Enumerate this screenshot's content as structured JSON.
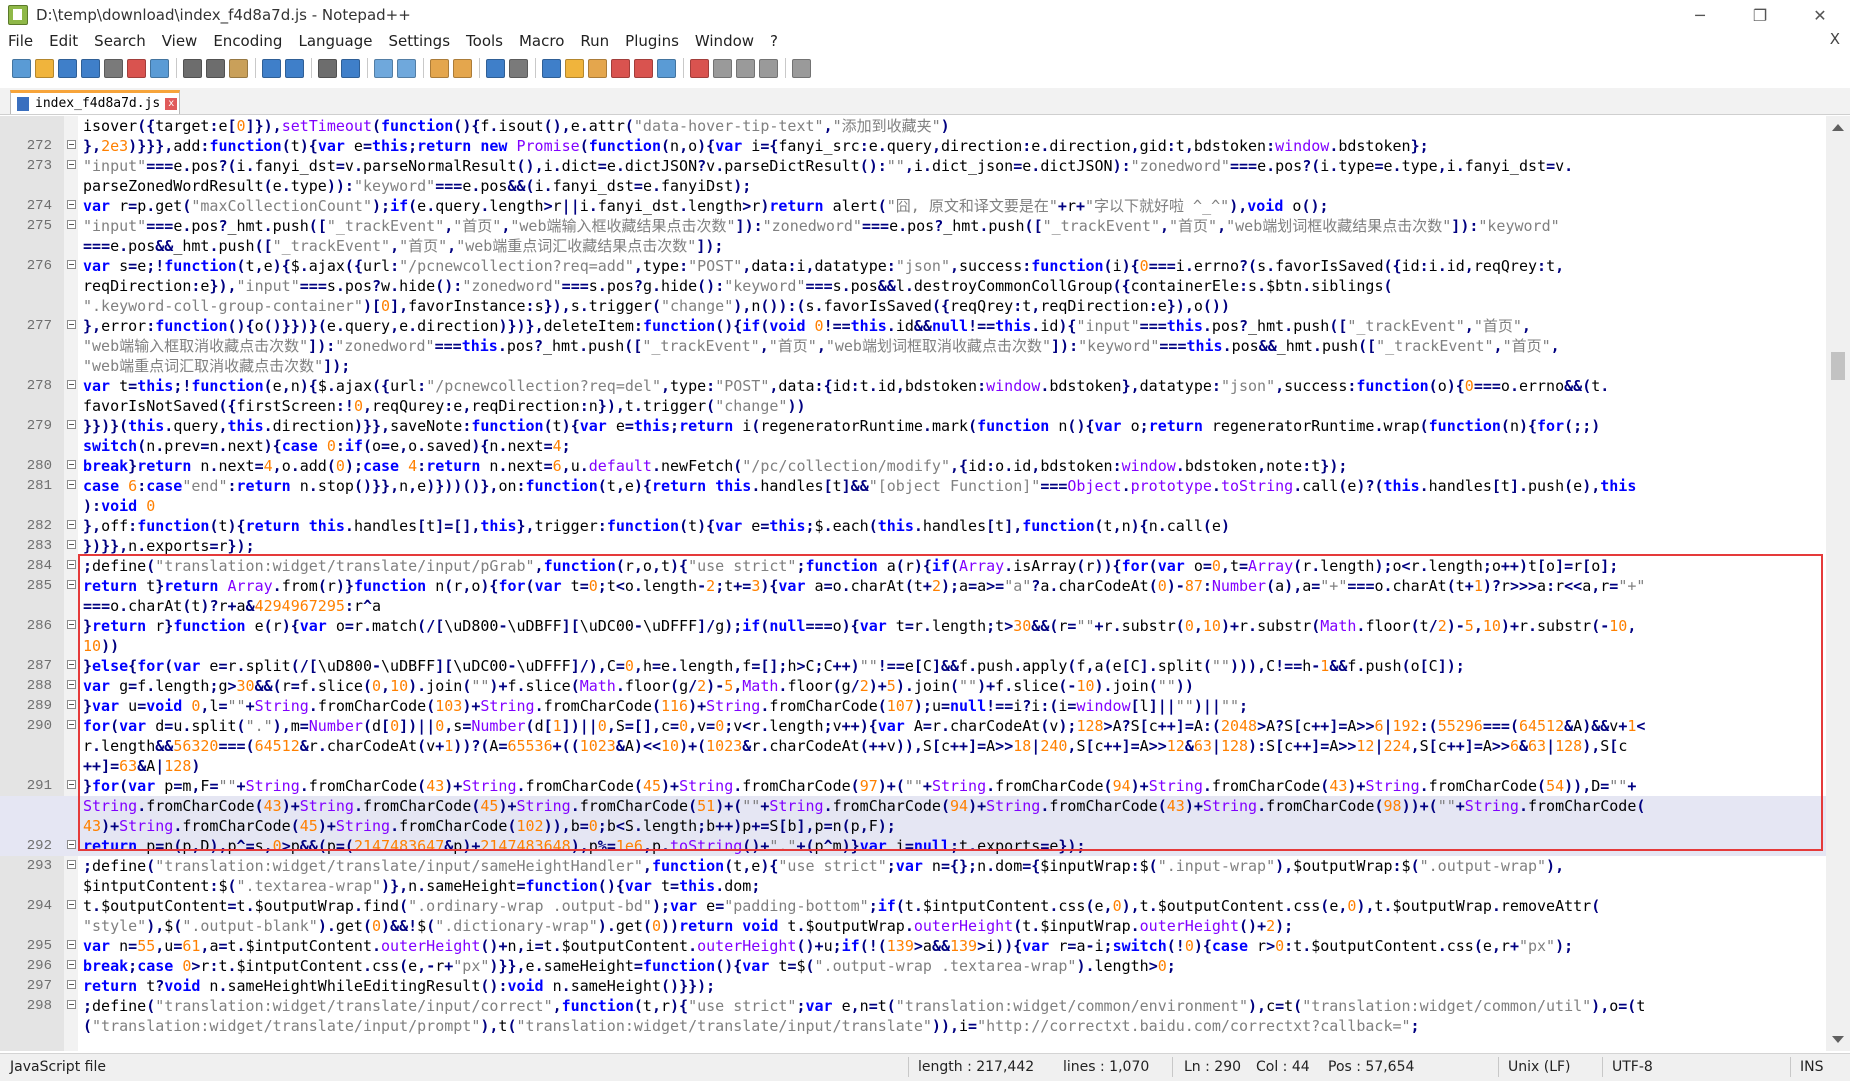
{
  "window": {
    "title": "D:\\temp\\download\\index_f4d8a7d.js - Notepad++",
    "minimize": "─",
    "restore": "❐",
    "close": "✕"
  },
  "menu": [
    "File",
    "Edit",
    "Search",
    "View",
    "Encoding",
    "Language",
    "Settings",
    "Tools",
    "Macro",
    "Run",
    "Plugins",
    "Window",
    "?"
  ],
  "menu_close": "X",
  "tab": {
    "label": "index_f4d8a7d.js",
    "close": "x"
  },
  "lines": [
    {
      "n": "",
      "t": "isover({target:e[0]}),setTimeout(function(){f.isout(),e.attr(\"data-hover-tip-text\",\"添加到收藏夹\")"
    },
    {
      "n": "272",
      "t": "},2e3)}}},add:function(t){var e=this;return new Promise(function(n,o){var i={fanyi_src:e.query,direction:e.direction,gid:t,bdstoken:window.bdstoken};"
    },
    {
      "n": "273",
      "t": "\"input\"===e.pos?(i.fanyi_dst=v.parseNormalResult(),i.dict=e.dictJSON?v.parseDictResult():\"\",i.dict_json=e.dictJSON):\"zonedword\"===e.pos?(i.type=e.type,i.fanyi_dst=v."
    },
    {
      "n": "",
      "t": "parseZonedWordResult(e.type)):\"keyword\"===e.pos&&(i.fanyi_dst=e.fanyiDst);"
    },
    {
      "n": "274",
      "t": "var r=p.get(\"maxCollectionCount\");if(e.query.length>r||i.fanyi_dst.length>r)return alert(\"囧, 原文和译文要是在\"+r+\"字以下就好啦 ^_^\"),void o();"
    },
    {
      "n": "275",
      "t": "\"input\"===e.pos?_hmt.push([\"_trackEvent\",\"首页\",\"web端输入框收藏结果点击次数\"]):\"zonedword\"===e.pos?_hmt.push([\"_trackEvent\",\"首页\",\"web端划词框收藏结果点击次数\"]):\"keyword\""
    },
    {
      "n": "",
      "t": "===e.pos&&_hmt.push([\"_trackEvent\",\"首页\",\"web端重点词汇收藏结果点击次数\"]);"
    },
    {
      "n": "276",
      "t": "var s=e;!function(t,e){$.ajax({url:\"/pcnewcollection?req=add\",type:\"POST\",data:i,datatype:\"json\",success:function(i){0===i.errno?(s.favorIsSaved({id:i.id,reqQrey:t,"
    },
    {
      "n": "",
      "t": "reqDirection:e}),\"input\"===s.pos?w.hide():\"zonedword\"===s.pos?g.hide():\"keyword\"===s.pos&&l.destroyCommonCollGroup({containerEle:s.$btn.siblings("
    },
    {
      "n": "",
      "t": "\".keyword-coll-group-container\")[0],favorInstance:s}),s.trigger(\"change\"),n()):(s.favorIsSaved({reqQrey:t,reqDirection:e}),o())"
    },
    {
      "n": "277",
      "t": "},error:function(){o()}})}(e.query,e.direction)})},deleteItem:function(){if(void 0!==this.id&&null!==this.id){\"input\"===this.pos?_hmt.push([\"_trackEvent\",\"首页\","
    },
    {
      "n": "",
      "t": "\"web端输入框取消收藏点击次数\"]):\"zonedword\"===this.pos?_hmt.push([\"_trackEvent\",\"首页\",\"web端划词框取消收藏点击次数\"]):\"keyword\"===this.pos&&_hmt.push([\"_trackEvent\",\"首页\","
    },
    {
      "n": "",
      "t": "\"web端重点词汇取消收藏点击次数\"]);"
    },
    {
      "n": "278",
      "t": "var t=this;!function(e,n){$.ajax({url:\"/pcnewcollection?req=del\",type:\"POST\",data:{id:t.id,bdstoken:window.bdstoken},datatype:\"json\",success:function(o){0===o.errno&&(t."
    },
    {
      "n": "",
      "t": "favorIsNotSaved({firstScreen:!0,reqQurey:e,reqDirection:n}),t.trigger(\"change\"))"
    },
    {
      "n": "279",
      "t": "}})}(this.query,this.direction)}},saveNote:function(t){var e=this;return i(regeneratorRuntime.mark(function n(){var o;return regeneratorRuntime.wrap(function(n){for(;;)"
    },
    {
      "n": "",
      "t": "switch(n.prev=n.next){case 0:if(o=e,o.saved){n.next=4;"
    },
    {
      "n": "280",
      "t": "break}return n.next=4,o.add(0);case 4:return n.next=6,u.default.newFetch(\"/pc/collection/modify\",{id:o.id,bdstoken:window.bdstoken,note:t});"
    },
    {
      "n": "281",
      "t": "case 6:case\"end\":return n.stop()}},n,e)}))()},on:function(t,e){return this.handles[t]&&\"[object Function]\"===Object.prototype.toString.call(e)?(this.handles[t].push(e),this"
    },
    {
      "n": "",
      "t": "):void 0"
    },
    {
      "n": "282",
      "t": "},off:function(t){return this.handles[t]=[],this},trigger:function(t){var e=this;$.each(this.handles[t],function(t,n){n.call(e)"
    },
    {
      "n": "283",
      "t": "})}},n.exports=r});"
    },
    {
      "n": "284",
      "t": ";define(\"translation:widget/translate/input/pGrab\",function(r,o,t){\"use strict\";function a(r){if(Array.isArray(r)){for(var o=0,t=Array(r.length);o<r.length;o++)t[o]=r[o];"
    },
    {
      "n": "285",
      "t": "return t}return Array.from(r)}function n(r,o){for(var t=0;t<o.length-2;t+=3){var a=o.charAt(t+2);a=a>=\"a\"?a.charCodeAt(0)-87:Number(a),a=\"+\"===o.charAt(t+1)?r>>>a:r<<a,r=\"+\""
    },
    {
      "n": "",
      "t": "===o.charAt(t)?r+a&4294967295:r^a"
    },
    {
      "n": "286",
      "t": "}return r}function e(r){var o=r.match(/[\\uD800-\\uDBFF][\\uDC00-\\uDFFF]/g);if(null===o){var t=r.length;t>30&&(r=\"\"+r.substr(0,10)+r.substr(Math.floor(t/2)-5,10)+r.substr(-10,"
    },
    {
      "n": "",
      "t": "10))"
    },
    {
      "n": "287",
      "t": "}else{for(var e=r.split(/[\\uD800-\\uDBFF][\\uDC00-\\uDFFF]/),C=0,h=e.length,f=[];h>C;C++)\"\"!==e[C]&&f.push.apply(f,a(e[C].split(\"\"))),C!==h-1&&f.push(o[C]);"
    },
    {
      "n": "288",
      "t": "var g=f.length;g>30&&(r=f.slice(0,10).join(\"\")+f.slice(Math.floor(g/2)-5,Math.floor(g/2)+5).join(\"\")+f.slice(-10).join(\"\"))"
    },
    {
      "n": "289",
      "t": "}var u=void 0,l=\"\"+String.fromCharCode(103)+String.fromCharCode(116)+String.fromCharCode(107);u=null!==i?i:(i=window[l]||\"\")||\"\";"
    },
    {
      "n": "290",
      "t": "for(var d=u.split(\".\"),m=Number(d[0])||0,s=Number(d[1])||0,S=[],c=0,v=0;v<r.length;v++){var A=r.charCodeAt(v);128>A?S[c++]=A:(2048>A?S[c++]=A>>6|192:(55296===(64512&A)&&v+1<"
    },
    {
      "n": "",
      "t": "r.length&&56320===(64512&r.charCodeAt(v+1))?(A=65536+((1023&A)<<10)+(1023&r.charCodeAt(++v)),S[c++]=A>>18|240,S[c++]=A>>12&63|128):S[c++]=A>>12|224,S[c++]=A>>6&63|128),S[c"
    },
    {
      "n": "",
      "t": "++]=63&A|128)"
    },
    {
      "n": "291",
      "t": "}for(var p=m,F=\"\"+String.fromCharCode(43)+String.fromCharCode(45)+String.fromCharCode(97)+(\"\"+String.fromCharCode(94)+String.fromCharCode(43)+String.fromCharCode(54)),D=\"\"+"
    },
    {
      "n": "",
      "t": "String.fromCharCode(43)+String.fromCharCode(45)+String.fromCharCode(51)+(\"\"+String.fromCharCode(94)+String.fromCharCode(43)+String.fromCharCode(98))+(\"\"+String.fromCharCode("
    },
    {
      "n": "",
      "t": "43)+String.fromCharCode(45)+String.fromCharCode(102)),b=0;b<S.length;b++)p+=S[b],p=n(p,F);"
    },
    {
      "n": "292",
      "t": "return p=n(p,D),p^=s,0>p&&(p=(2147483647&p)+2147483648),p%=1e6,p.toString()+\".\"+(p^m)}var i=null;t.exports=e});"
    },
    {
      "n": "293",
      "t": ";define(\"translation:widget/translate/input/sameHeightHandler\",function(t,e){\"use strict\";var n={};n.dom={$inputWrap:$(\".input-wrap\"),$outputWrap:$(\".output-wrap\"),"
    },
    {
      "n": "",
      "t": "$intputContent:$(\".textarea-wrap\")},n.sameHeight=function(){var t=this.dom;"
    },
    {
      "n": "294",
      "t": "t.$outputContent=t.$outputWrap.find(\".ordinary-wrap .output-bd\");var e=\"padding-bottom\";if(t.$intputContent.css(e,0),t.$outputContent.css(e,0),t.$outputWrap.removeAttr("
    },
    {
      "n": "",
      "t": "\"style\"),$(\".output-blank\").get(0)&&!$(\".dictionary-wrap\").get(0))return void t.$outputWrap.outerHeight(t.$inputWrap.outerHeight()+2);"
    },
    {
      "n": "295",
      "t": "var n=55,u=61,a=t.$intputContent.outerHeight()+n,i=t.$outputContent.outerHeight()+u;if(!(139>a&&139>i)){var r=a-i;switch(!0){case r>0:t.$outputContent.css(e,r+\"px\");"
    },
    {
      "n": "296",
      "t": "break;case 0>r:t.$intputContent.css(e,-r+\"px\")}},e.sameHeight=function(){var t=$(\".output-wrap .textarea-wrap\").length>0;"
    },
    {
      "n": "297",
      "t": "return t?void n.sameHeightWhileEditingResult():void n.sameHeight()}});"
    },
    {
      "n": "298",
      "t": ";define(\"translation:widget/translate/input/correct\",function(t,r){\"use strict\";var e,n=t(\"translation:widget/common/environment\"),c=t(\"translation:widget/common/util\"),o=(t"
    },
    {
      "n": "",
      "t": "(\"translation:widget/translate/input/prompt\"),t(\"translation:widget/translate/input/translate\")),i=\"http://correctxt.baidu.com/correctxt?callback=\";"
    }
  ],
  "status": {
    "file_type": "JavaScript file",
    "length": "length : 217,442",
    "lines": "lines : 1,070",
    "ln": "Ln : 290",
    "col": "Col : 44",
    "pos": "Pos : 57,654",
    "eol": "Unix (LF)",
    "encoding": "UTF-8",
    "mode": "INS"
  },
  "colors": {
    "highlight_box": "#e53a3a",
    "selection": "#e5e6f3",
    "keyword": "#0000ff",
    "string": "#808080",
    "number": "#ff8000"
  }
}
